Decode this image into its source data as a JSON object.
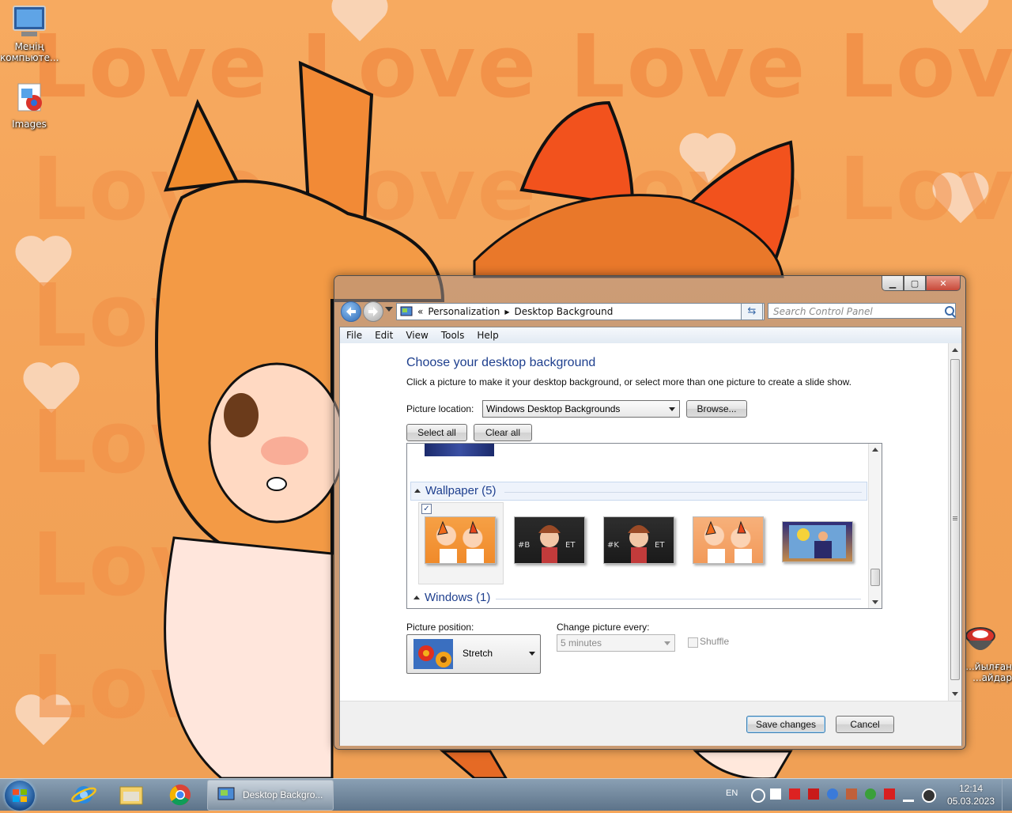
{
  "desktop": {
    "wallpaper_words": [
      "Love Love Love Love",
      "Love Love Love Love",
      "Love",
      "Love",
      "Love",
      "Love"
    ],
    "icons": [
      {
        "label": "Менің компьюте...",
        "icon": "computer-icon"
      },
      {
        "label": "Images",
        "icon": "images-icon"
      },
      {
        "label": "...йылған ...айдар",
        "icon": "recycle-bin-icon"
      }
    ]
  },
  "window": {
    "title": "Desktop Background",
    "breadcrumb": [
      "Personalization",
      "Desktop Background"
    ],
    "breadcrumb_prefix": "«",
    "search_placeholder": "Search Control Panel",
    "menu": [
      "File",
      "Edit",
      "View",
      "Tools",
      "Help"
    ],
    "heading": "Choose your desktop background",
    "description": "Click a picture to make it your desktop background, or select more than one picture to create a slide show.",
    "picture_location_label": "Picture location:",
    "picture_location_value": "Windows Desktop Backgrounds",
    "browse_label": "Browse...",
    "select_all_label": "Select all",
    "clear_all_label": "Clear all",
    "groups": [
      {
        "label": "Wallpaper (5)",
        "expanded": true
      },
      {
        "label": "Windows (1)",
        "expanded": true
      }
    ],
    "wallpaper_thumbs": [
      {
        "name": "Two catgirls on orange",
        "selected": true
      },
      {
        "name": "Dark banner 1",
        "selected": false
      },
      {
        "name": "Dark banner 2",
        "selected": false
      },
      {
        "name": "Orange pattern",
        "selected": false
      },
      {
        "name": "Sun scene",
        "selected": false
      }
    ],
    "picture_position_label": "Picture position:",
    "picture_position_value": "Stretch",
    "change_every_label": "Change picture every:",
    "change_every_value": "5 minutes",
    "shuffle_label": "Shuffle",
    "save_label": "Save changes",
    "cancel_label": "Cancel",
    "colors": {
      "heading": "#1e3f8e",
      "accent": "#3c7fb1"
    }
  },
  "taskbar": {
    "task_label": "Desktop Backgro...",
    "language": "EN",
    "time": "12:14",
    "date": "05.03.2023"
  }
}
